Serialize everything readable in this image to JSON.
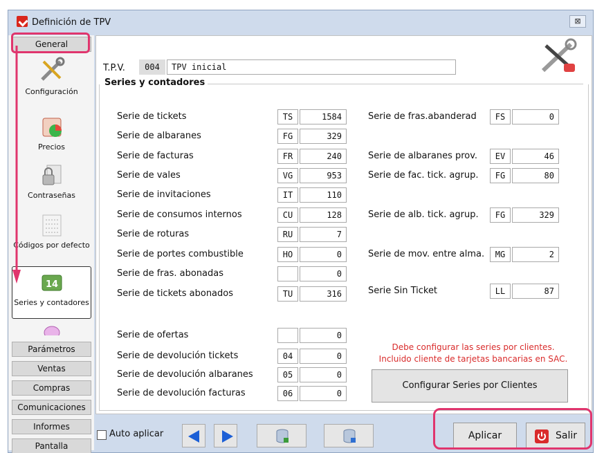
{
  "window": {
    "title": "Definición de TPV",
    "close_glyph": "⊠"
  },
  "nav": {
    "general": "General",
    "items": [
      {
        "label": "Configuración",
        "icon": "tools-icon"
      },
      {
        "label": "Precios",
        "icon": "price-chart-icon"
      },
      {
        "label": "Contraseñas",
        "icon": "lock-icon"
      },
      {
        "label": "Códigos por defecto",
        "icon": "codes-icon"
      },
      {
        "label": "Series y contadores",
        "icon": "counter-icon"
      }
    ],
    "tabs": [
      "Parámetros",
      "Ventas",
      "Compras",
      "Comunicaciones",
      "Informes",
      "Pantalla"
    ]
  },
  "tpv": {
    "label": "T.P.V.",
    "code": "004",
    "name": "TPV inicial"
  },
  "section": {
    "title": "Series y contadores"
  },
  "left_rows": [
    {
      "label": "Serie de tickets",
      "code": "TS",
      "value": "1584"
    },
    {
      "label": "Serie de albaranes",
      "code": "FG",
      "value": "329"
    },
    {
      "label": "Serie de facturas",
      "code": "FR",
      "value": "240"
    },
    {
      "label": "Serie de vales",
      "code": "VG",
      "value": "953"
    },
    {
      "label": "Serie de invitaciones",
      "code": "IT",
      "value": "110"
    },
    {
      "label": "Serie de consumos internos",
      "code": "CU",
      "value": "128"
    },
    {
      "label": "Serie de roturas",
      "code": "RU",
      "value": "7"
    },
    {
      "label": "Serie de portes combustible",
      "code": "HO",
      "value": "0"
    },
    {
      "label": "Serie de fras. abonadas",
      "code": "",
      "value": "0"
    },
    {
      "label": "Serie de tickets abonados",
      "code": "TU",
      "value": "316"
    },
    {
      "label": "Serie de ofertas",
      "code": "",
      "value": "0"
    },
    {
      "label": "Serie de devolución tickets",
      "code": "04",
      "value": "0"
    },
    {
      "label": "Serie de devolución albaranes",
      "code": "05",
      "value": "0"
    },
    {
      "label": "Serie de devolución facturas",
      "code": "06",
      "value": "0"
    }
  ],
  "right_rows": [
    {
      "label": "Serie de fras.abanderad",
      "code": "FS",
      "value": "0"
    },
    {
      "label": "Serie de albaranes prov.",
      "code": "EV",
      "value": "46"
    },
    {
      "label": "Serie de fac. tick. agrup.",
      "code": "FG",
      "value": "80"
    },
    {
      "label": "Serie de alb. tick. agrup.",
      "code": "FG",
      "value": "329"
    },
    {
      "label": "Serie de mov. entre alma.",
      "code": "MG",
      "value": "2"
    },
    {
      "label": "Serie Sin Ticket",
      "code": "LL",
      "value": "87"
    }
  ],
  "warning": {
    "line1": "Debe configurar las series por clientes.",
    "line2": "Incluido cliente de tarjetas bancarias en SAC."
  },
  "buttons": {
    "config_series": "Configurar Series por Clientes",
    "auto_apply": "Auto aplicar",
    "apply": "Aplicar",
    "exit": "Salir"
  },
  "colors": {
    "highlight": "#e0356d",
    "warning": "#d92b2b",
    "accent": "#1c5fd6"
  }
}
